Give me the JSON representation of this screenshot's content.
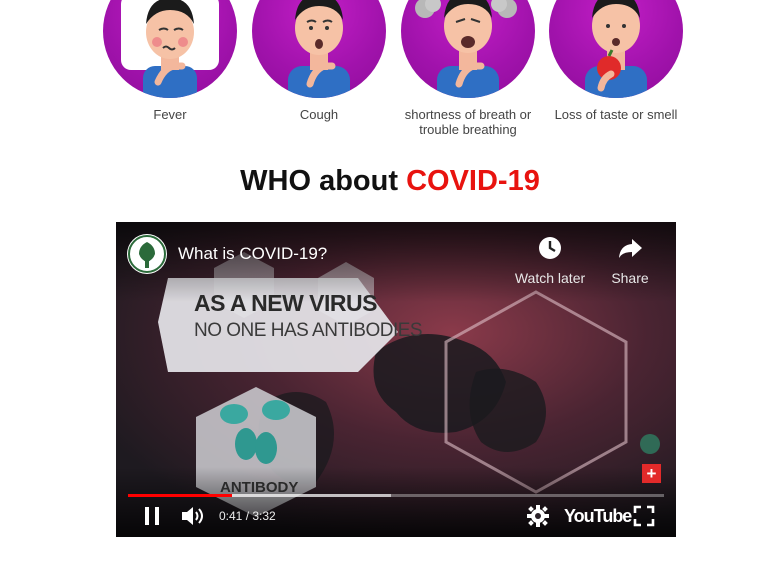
{
  "symptoms": [
    {
      "label": "Fever",
      "icon": "fever-person-icon"
    },
    {
      "label": "Cough",
      "icon": "cough-person-icon"
    },
    {
      "label": "shortness of breath or trouble breathing",
      "icon": "breathing-person-icon"
    },
    {
      "label": "Loss of taste or smell",
      "icon": "taste-loss-person-icon"
    }
  ],
  "heading": {
    "prefix": "WHO about",
    "accent": "COVID-19"
  },
  "video": {
    "title": "What is COVID-19?",
    "watch_later_label": "Watch later",
    "share_label": "Share",
    "overlay_line1": "AS A NEW VIRUS",
    "overlay_line2": "NO ONE HAS ANTIBODIES",
    "antibody_label": "ANTIBODY",
    "current_time": "0:41",
    "duration": "3:32",
    "time_readout": "0:41 / 3:32",
    "progress_fraction": 0.194,
    "buffered_fraction": 0.49,
    "youtube_label": "YouTube",
    "badge_symbol": "+"
  },
  "colors": {
    "accent_red": "#e8130f",
    "avatar_purple": "#a012ab",
    "progress_red": "#ff0000"
  }
}
